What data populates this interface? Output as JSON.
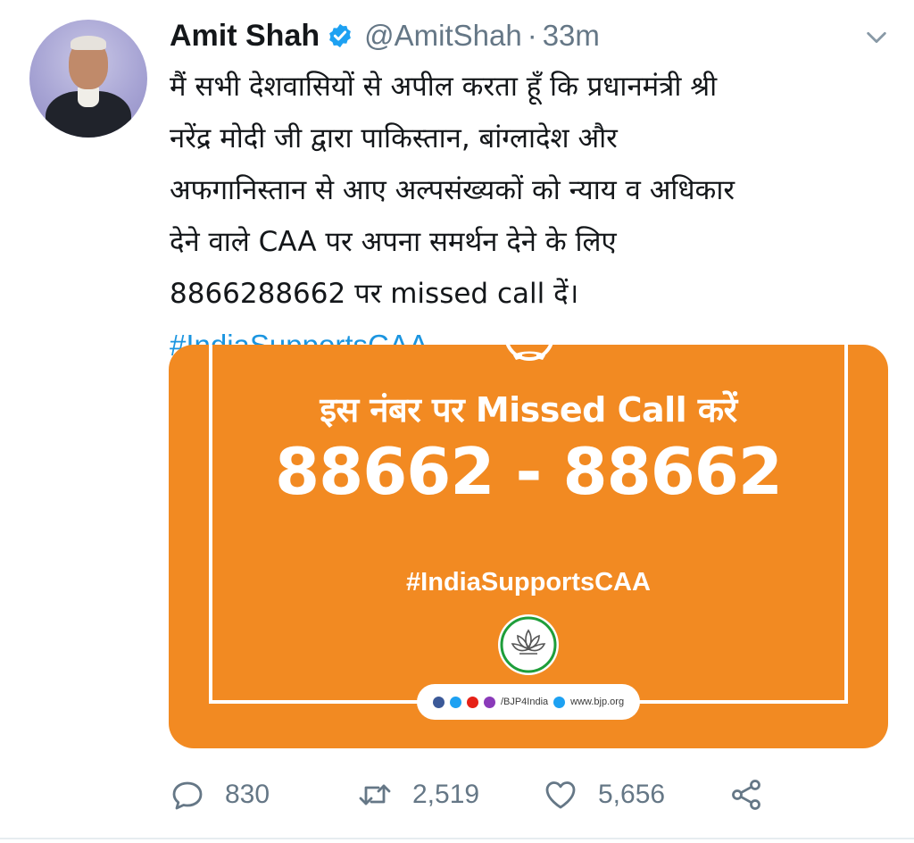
{
  "tweet": {
    "author_name": "Amit Shah",
    "handle": "@AmitShah",
    "separator": "·",
    "time": "33m",
    "text_lines": [
      "मैं सभी देशवासियों से अपील करता हूँ कि प्रधानमंत्री श्री",
      "नरेंद्र मोदी जी द्वारा पाकिस्तान, बांग्लादेश और",
      "अफगानिस्तान से आए अल्पसंख्यकों को न्याय व अधिकार",
      "देने वाले CAA पर अपना समर्थन देने के लिए",
      "8866288662 पर missed call दें।"
    ],
    "hashtag": "#IndiaSupportsCAA",
    "icons": {
      "verified": "verified-badge-icon",
      "menu": "chevron-down-icon"
    }
  },
  "card": {
    "headline": "इस नंबर पर Missed Call करें",
    "number": "88662 - 88662",
    "hashtag": "#IndiaSupportsCAA",
    "footer_handle": "/BJP4India",
    "footer_site": "www.bjp.org",
    "background_color": "#f28a22"
  },
  "actions": {
    "reply_count": "830",
    "retweet_count": "2,519",
    "like_count": "5,656"
  },
  "colors": {
    "accent": "#1b95e0",
    "muted": "#657786",
    "verified": "#1da1f2"
  }
}
